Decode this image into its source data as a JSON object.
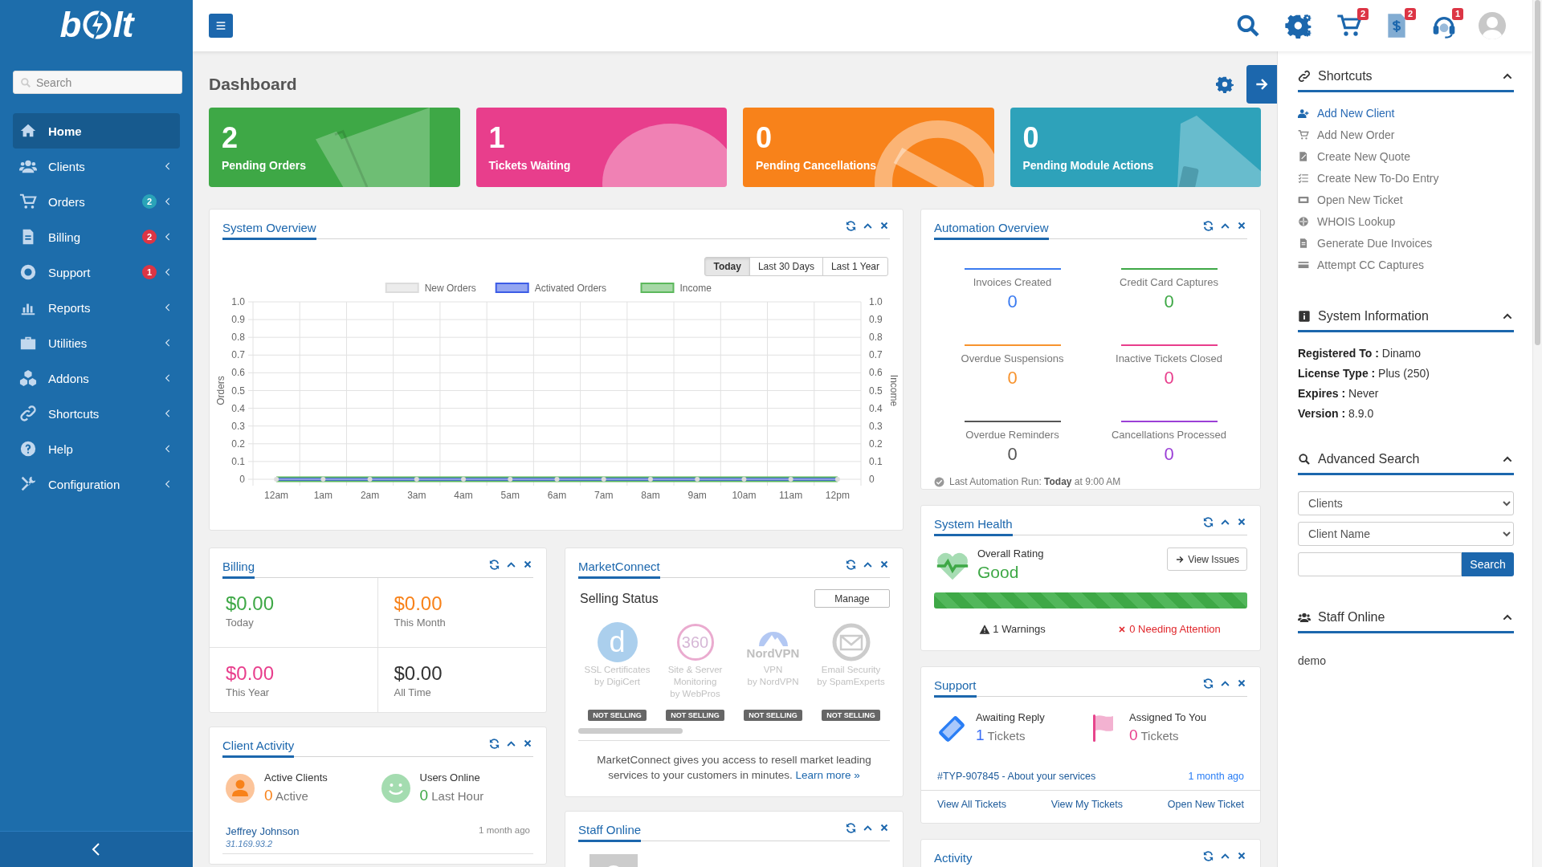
{
  "sidebar": {
    "logo": {
      "start": "b",
      "end": "lt"
    },
    "search": {
      "placeholder": "Search"
    },
    "items": [
      {
        "label": "Home",
        "selected": true,
        "submenu": false
      },
      {
        "label": "Clients",
        "selected": false,
        "submenu": true
      },
      {
        "label": "Orders",
        "selected": false,
        "submenu": true,
        "badge": "2",
        "color": "#2aa3b8"
      },
      {
        "label": "Billing",
        "selected": false,
        "submenu": true,
        "badge": "2",
        "color": "#dc3545"
      },
      {
        "label": "Support",
        "selected": false,
        "submenu": true,
        "badge": "1",
        "color": "#dc3545"
      },
      {
        "label": "Reports",
        "selected": false,
        "submenu": true
      },
      {
        "label": "Utilities",
        "selected": false,
        "submenu": true
      },
      {
        "label": "Addons",
        "selected": false,
        "submenu": true
      },
      {
        "label": "Shortcuts",
        "selected": false,
        "submenu": true
      },
      {
        "label": "Help",
        "selected": false,
        "submenu": true
      },
      {
        "label": "Configuration",
        "selected": false,
        "submenu": true
      }
    ]
  },
  "topbar": {
    "notifications": [
      {
        "badge": "2"
      },
      {
        "badge": "2"
      },
      {
        "badge": "1"
      }
    ]
  },
  "page_title": "Dashboard",
  "stat_cards": [
    {
      "count": "2",
      "label": "Pending Orders",
      "color": "#3ea846"
    },
    {
      "count": "1",
      "label": "Tickets Waiting",
      "color": "#e83e8c"
    },
    {
      "count": "0",
      "label": "Pending Cancellations",
      "color": "#f8821a"
    },
    {
      "count": "0",
      "label": "Pending Module Actions",
      "color": "#2ea2ba"
    }
  ],
  "widgets": [
    {
      "kind": "system_overview",
      "title": "System Overview",
      "ranges": [
        {
          "label": "Today",
          "selected": true
        },
        {
          "label": "Last 30 Days",
          "selected": false
        },
        {
          "label": "Last 1 Year",
          "selected": false
        }
      ],
      "chart_data": {
        "type": "line",
        "ylabel": "Orders",
        "y2label": "Income",
        "categories": [
          "12am",
          "1am",
          "2am",
          "3am",
          "4am",
          "5am",
          "6am",
          "7am",
          "8am",
          "9am",
          "10am",
          "11am",
          "12pm"
        ],
        "series": [
          {
            "name": "New Orders",
            "color": "#dcdcdc",
            "marker": "circle",
            "values": [
              0,
              0,
              0,
              0,
              0,
              0,
              0,
              0,
              0,
              0,
              0,
              0,
              0
            ]
          },
          {
            "name": "Activated Orders",
            "color": "#3c5ce6",
            "values": [
              0,
              0,
              0,
              0,
              0,
              0,
              0,
              0,
              0,
              0,
              0,
              0,
              0
            ]
          },
          {
            "name": "Income",
            "color": "#5cb85c",
            "values": [
              0,
              0,
              0,
              0,
              0,
              0,
              0,
              0,
              0,
              0,
              0,
              0,
              0
            ]
          }
        ],
        "legend": "top",
        "ylim": [
          0,
          1
        ],
        "y2lim": [
          0,
          1
        ],
        "yticks": [
          0,
          0.1,
          0.2,
          0.3,
          0.4,
          0.5,
          0.6,
          0.7,
          0.8,
          0.9,
          {
            "value": 1,
            "label": "1.0"
          }
        ],
        "y2ticks": [
          0,
          0.1,
          0.2,
          0.3,
          0.4,
          0.5,
          0.6,
          0.7,
          0.8,
          0.9,
          {
            "value": 1,
            "label": "1.0"
          }
        ]
      }
    },
    {
      "kind": "automation_overview",
      "title": "Automation Overview",
      "stats": [
        {
          "label": "Invoices Created",
          "value": "0",
          "color": "#3b7bf0"
        },
        {
          "label": "Credit Card Captures",
          "value": "0",
          "color": "#3ea846"
        },
        {
          "label": "Overdue Suspensions",
          "value": "0",
          "color": "#f7932e"
        },
        {
          "label": "Inactive Tickets Closed",
          "value": "0",
          "color": "#e83e8c"
        },
        {
          "label": "Overdue Reminders",
          "value": "0",
          "color": "#555555"
        },
        {
          "label": "Cancellations Processed",
          "value": "0",
          "color": "#9b3fd6"
        }
      ],
      "last_run": "Last Automation Run: **Today** at 9:00 AM"
    },
    {
      "kind": "system_health",
      "title": "System Health",
      "rating_label": "Overall Rating",
      "rating": "Good",
      "button": "View Issues",
      "level": 1,
      "warnings": "1 Warnings",
      "attention": "0 Needing Attention"
    },
    {
      "kind": "support",
      "title": "Support",
      "counters": [
        {
          "label": "Awaiting Reply",
          "count": "1",
          "unit": "Tickets",
          "color": "#3b6ef5"
        },
        {
          "label": "Assigned To You",
          "count": "0",
          "unit": "Tickets",
          "color": "#e83e8c"
        }
      ],
      "tickets": [
        {
          "subject": "#TYP-907845 - About your services",
          "time": "1 month ago"
        }
      ],
      "links": [
        "View All Tickets",
        "View My Tickets",
        "Open New Ticket"
      ]
    },
    {
      "kind": "activity",
      "title": "Activity"
    },
    {
      "kind": "billing",
      "title": "Billing",
      "amounts": [
        {
          "amount": "$0.00",
          "label": "Today",
          "color": "#3ea846"
        },
        {
          "amount": "$0.00",
          "label": "This Month",
          "color": "#f8821a"
        },
        {
          "amount": "$0.00",
          "label": "This Year",
          "color": "#e83e8c"
        },
        {
          "amount": "$0.00",
          "label": "All Time",
          "color": "#333333"
        }
      ]
    },
    {
      "kind": "client_activity",
      "title": "Client Activity",
      "counters": [
        {
          "label": "Active Clients",
          "count": "0",
          "unit": "Active",
          "color": "#f8821a"
        },
        {
          "label": "Users Online",
          "count": "0",
          "unit": "Last Hour",
          "color": "#3ea846"
        }
      ],
      "sessions": [
        {
          "name": "Jeffrey Johnson",
          "ip": "31.169.93.2",
          "time": "1 month ago"
        }
      ]
    },
    {
      "kind": "marketconnect",
      "title": "MarketConnect",
      "heading": "Selling Status",
      "button": "Manage",
      "services": [
        {
          "logo_text": "d",
          "name": "SSL Certificates",
          "vendor": "by DigiCert",
          "status": "NOT SELLING"
        },
        {
          "logo_text": "360",
          "name": "Site & Server Monitoring",
          "vendor": "by WebPros",
          "status": "NOT SELLING"
        },
        {
          "logo_text": "NordVPN",
          "name": "VPN",
          "vendor": "by NordVPN",
          "status": "NOT SELLING"
        },
        {
          "name": "Email Security",
          "vendor": "by SpamExperts",
          "status": "NOT SELLING"
        }
      ],
      "description": "MarketConnect gives you access to resell market leading services to your customers in minutes.",
      "link": "Learn more »"
    },
    {
      "kind": "staff_online",
      "title": "Staff Online"
    }
  ],
  "right_panel": {
    "shortcuts": {
      "title": "Shortcuts",
      "items": [
        {
          "label": "Add New Client",
          "highlighted": true
        },
        {
          "label": "Add New Order",
          "highlighted": false
        },
        {
          "label": "Create New Quote",
          "highlighted": false
        },
        {
          "label": "Create New To-Do Entry",
          "highlighted": false
        },
        {
          "label": "Open New Ticket",
          "highlighted": false
        },
        {
          "label": "WHOIS Lookup",
          "highlighted": false
        },
        {
          "label": "Generate Due Invoices",
          "highlighted": false
        },
        {
          "label": "Attempt CC Captures",
          "highlighted": false
        }
      ]
    },
    "system_information": {
      "title": "System Information",
      "rows": [
        {
          "label": "Registered To :",
          "value": "Dinamo"
        },
        {
          "label": "License Type :",
          "value": "Plus (250)"
        },
        {
          "label": "Expires :",
          "value": "Never"
        },
        {
          "label": "Version :",
          "value": "8.9.0"
        }
      ]
    },
    "advanced_search": {
      "title": "Advanced Search",
      "selects": [
        "Clients",
        "Client Name"
      ],
      "button": "Search"
    },
    "staff_online": {
      "title": "Staff Online",
      "staff": [
        "demo"
      ]
    }
  }
}
